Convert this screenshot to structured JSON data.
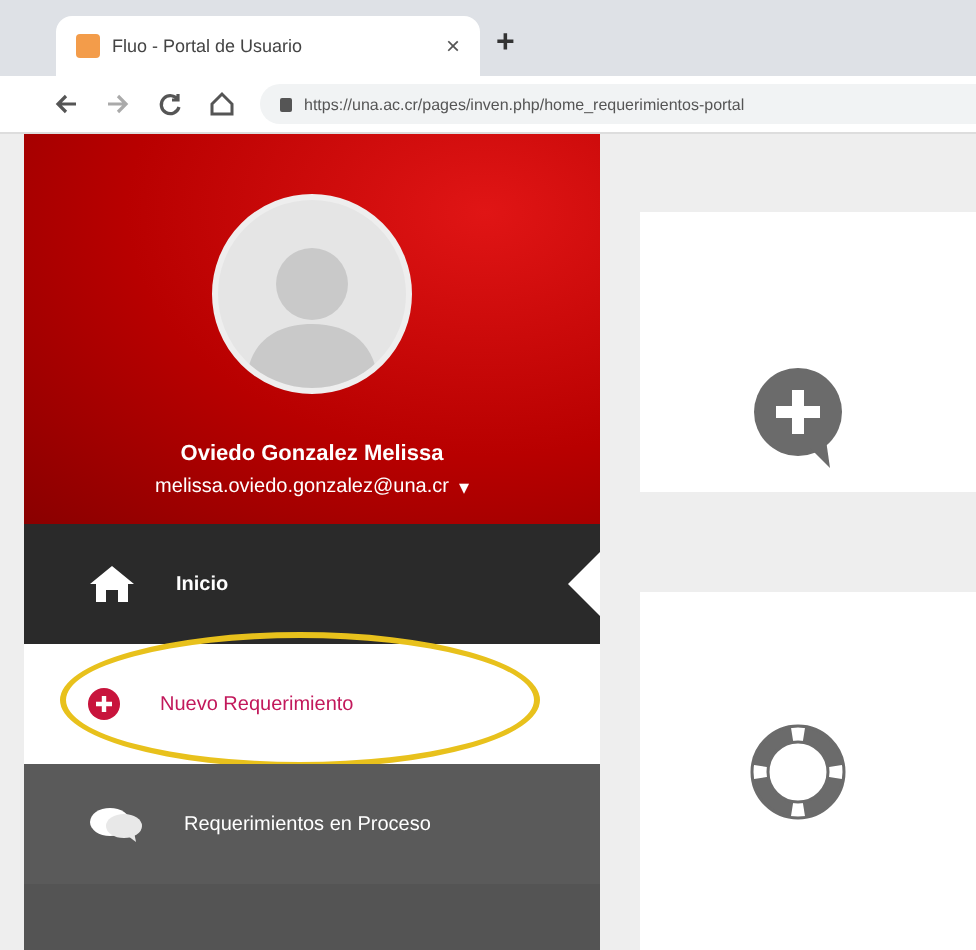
{
  "browser": {
    "tab": {
      "title": "Fluo - Portal de Usuario",
      "close": "×"
    },
    "new_tab": "+",
    "url": "https://una.ac.cr/pages/inven.php/home_requerimientos-portal"
  },
  "profile": {
    "name": "Oviedo Gonzalez Melissa",
    "email": "melissa.oviedo.gonzalez@una.cr",
    "caret": "▾"
  },
  "menu": [
    {
      "label": "Inicio",
      "selected": true,
      "highlighted": false
    },
    {
      "label": "Nuevo Requerimiento",
      "selected": false,
      "highlighted": true
    },
    {
      "label": "Requerimientos en Proceso",
      "selected": false,
      "highlighted": false
    }
  ]
}
